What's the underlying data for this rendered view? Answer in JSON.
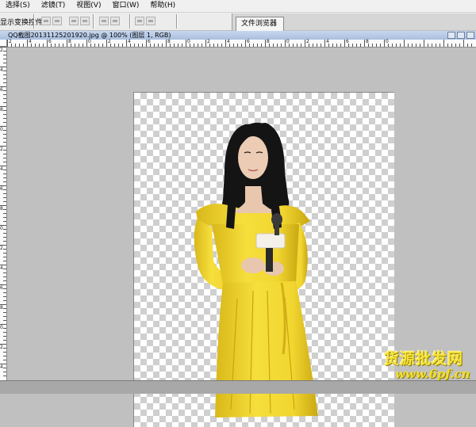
{
  "menubar": {
    "items": [
      "选择(S)",
      "滤镜(T)",
      "视图(V)",
      "窗口(W)",
      "帮助(H)"
    ]
  },
  "options_bar": {
    "label": "显示变换控件"
  },
  "panel_tabs": {
    "file_browser": "文件浏览器"
  },
  "document": {
    "title": "QQ截图20131125201920.jpg @ 100% (图层 1, RGB)"
  },
  "ruler": {
    "top_labels": [
      "2",
      "4",
      "6",
      "8",
      "0",
      "2",
      "4",
      "6",
      "8",
      "0",
      "2",
      "4",
      "6",
      "8",
      "0",
      "2",
      "4",
      "6",
      "8",
      "0"
    ],
    "left_labels": [
      "2",
      "4",
      "6",
      "8",
      "0",
      "2",
      "4",
      "6",
      "8",
      "0",
      "2",
      "4",
      "6",
      "8",
      "0",
      "2",
      "4",
      "6",
      "8",
      "0"
    ]
  },
  "watermark": {
    "chinese": "货源批发网",
    "url": "www.6pf.cn"
  },
  "colors": {
    "dress": "#f2d630",
    "hair": "#141414",
    "skin": "#e8c7ae",
    "workspace": "#c0c0c0",
    "watermark": "#f7e33a"
  }
}
